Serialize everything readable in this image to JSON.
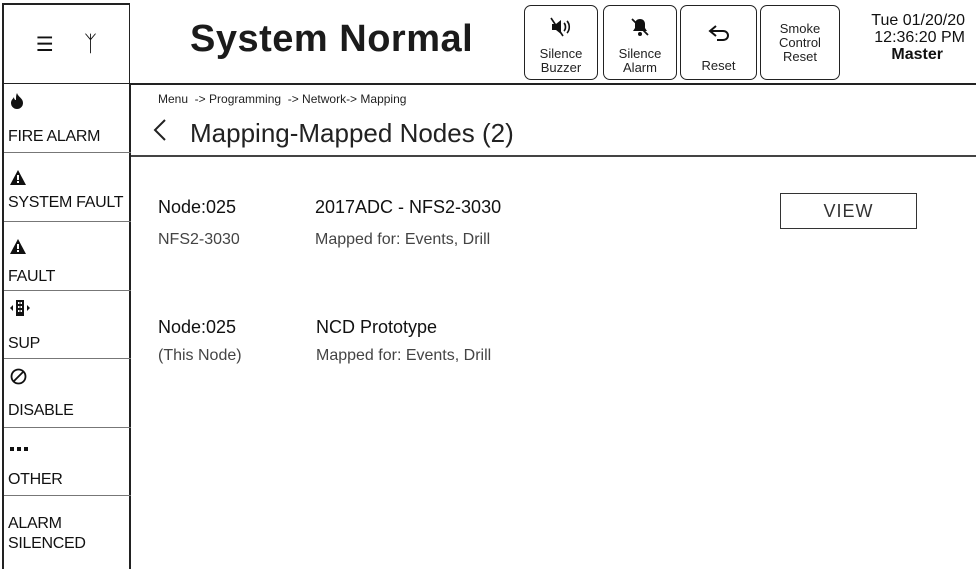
{
  "header": {
    "status": "System Normal",
    "buttons": {
      "silence_buzzer": [
        "Silence",
        "Buzzer"
      ],
      "silence_alarm": [
        "Silence",
        "Alarm"
      ],
      "reset": "Reset",
      "smoke_control_reset": [
        "Smoke",
        "Control",
        "Reset"
      ]
    },
    "datetime": {
      "date": "Tue 01/20/20",
      "time": "12:36:20 PM",
      "role": "Master"
    }
  },
  "sidebar": {
    "items": [
      {
        "label": "FIRE ALARM",
        "icon": "fire-icon"
      },
      {
        "label": "SYSTEM FAULT",
        "icon": "warning-icon"
      },
      {
        "label": "FAULT",
        "icon": "warning-icon"
      },
      {
        "label": "SUP",
        "icon": "supervisory-icon"
      },
      {
        "label": "DISABLE",
        "icon": "disable-icon"
      },
      {
        "label": "OTHER",
        "icon": "more-icon"
      },
      {
        "label_line1": "ALARM",
        "label_line2": "SILENCED"
      }
    ]
  },
  "page": {
    "breadcrumb": "Menu  -> Programming  -> Network-> Mapping",
    "title": "Mapping-Mapped Nodes (2)"
  },
  "nodes": [
    {
      "id": "Node:025",
      "sub": "NFS2-3030",
      "name": "2017ADC - NFS2-3030",
      "mapping": "Mapped for: Events, Drill",
      "action": "VIEW"
    },
    {
      "id": "Node:025",
      "sub": "(This Node)",
      "name": "NCD Prototype",
      "mapping": "Mapped for: Events, Drill"
    }
  ]
}
